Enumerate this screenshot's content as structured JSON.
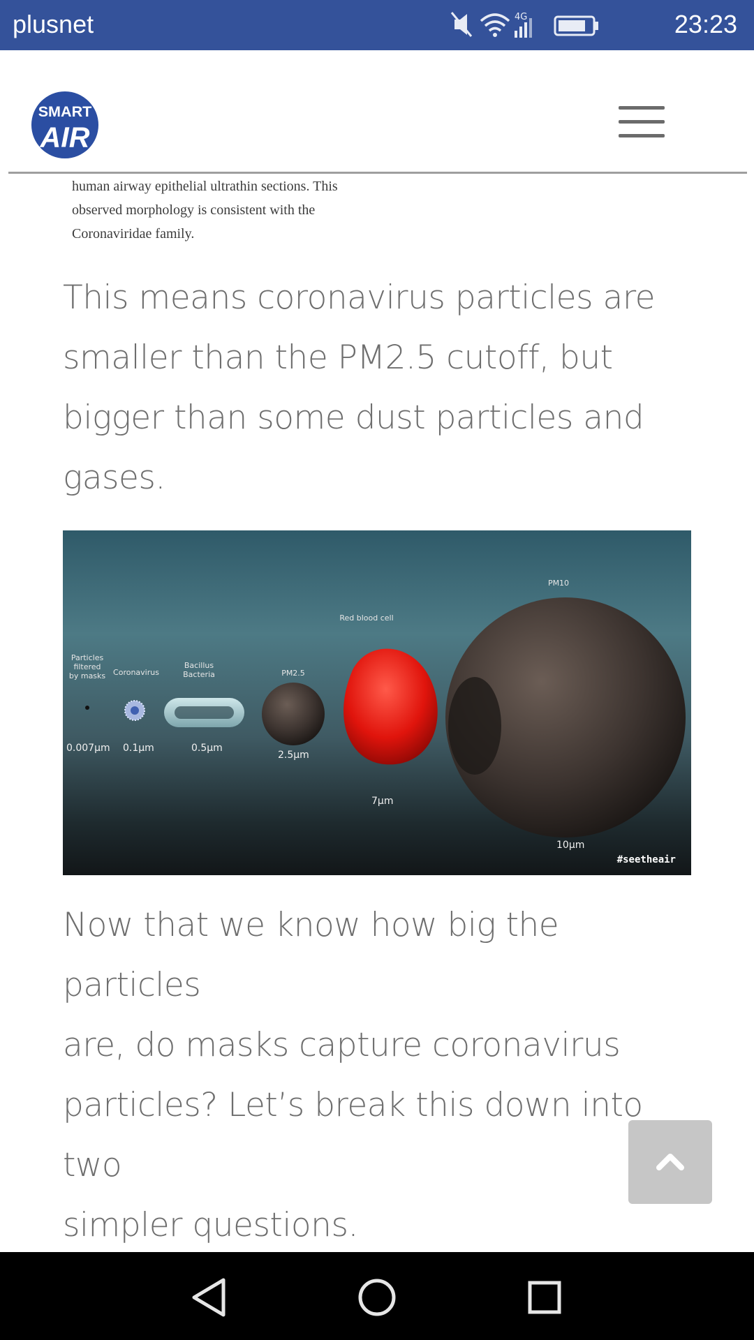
{
  "status_bar": {
    "carrier": "plusnet",
    "network": "4G",
    "time": "23:23",
    "background": "#34529a"
  },
  "header": {
    "logo_line1": "SMART",
    "logo_line2": "AIR",
    "logo_color": "#2b4ea2",
    "menu_icon": "hamburger-menu-icon"
  },
  "caption": {
    "lines": [
      "human airway epithelial ultrathin sections. This",
      "observed morphology is consistent with the",
      "Coronaviridae family."
    ]
  },
  "paragraph1": {
    "lines": [
      "This means coronavirus particles are",
      "smaller than the PM2.5 cutoff, but",
      "bigger than some dust particles and",
      "gases."
    ]
  },
  "figure": {
    "particles": [
      {
        "label_lines": [
          "Particles",
          "filtered",
          "by masks"
        ],
        "size": "0.007μm"
      },
      {
        "label_lines": [
          "Coronavirus"
        ],
        "size": "0.1μm"
      },
      {
        "label_lines": [
          "Bacillus",
          "Bacteria"
        ],
        "size": "0.5μm"
      },
      {
        "label_lines": [
          "PM2.5"
        ],
        "size": "2.5μm"
      },
      {
        "label_lines": [
          "Red blood cell"
        ],
        "size": "7μm"
      },
      {
        "label_lines": [
          "PM10"
        ],
        "size": "10μm"
      }
    ],
    "hashtag": "#seetheair"
  },
  "paragraph2": {
    "lines": [
      "Now that we know how big the particles",
      "are, do masks capture coronavirus",
      "particles? Let’s break this down into two",
      "simpler questions."
    ]
  },
  "scroll_top_icon": "chevron-up-icon",
  "nav": {
    "back_icon": "back-triangle-icon",
    "home_icon": "home-circle-icon",
    "recents_icon": "recents-square-icon"
  }
}
